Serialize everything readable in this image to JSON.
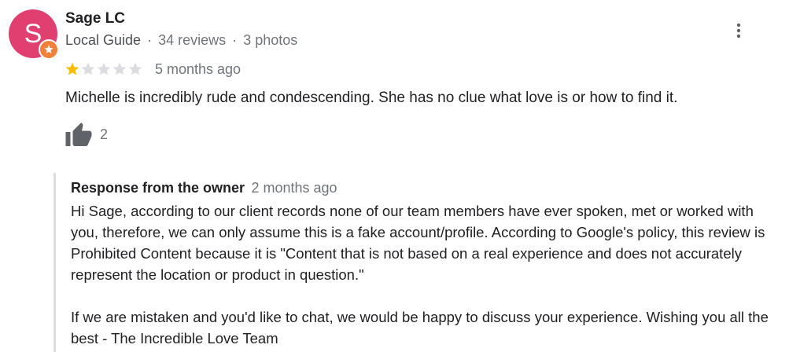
{
  "reviewer": {
    "avatar_letter": "S",
    "avatar_color": "#e13f70",
    "badge_color": "#f2803a",
    "name": "Sage LC",
    "level": "Local Guide",
    "reviews": "34 reviews",
    "photos": "3 photos",
    "separator": "·"
  },
  "review": {
    "rating": 1,
    "max_rating": 5,
    "star_color_filled": "#fbbc04",
    "star_color_empty": "#dadce0",
    "date": "5 months ago",
    "text": "Michelle is incredibly rude and condescending. She has no clue what love is or how to find it.",
    "likes": "2"
  },
  "owner_response": {
    "title": "Response from the owner",
    "date": "2 months ago",
    "paragraph_1": "Hi Sage, according to our client records none of our team members have ever spoken, met or worked with you, therefore, we can only assume this is a fake account/profile. According to Google's policy, this review is Prohibited Content because it is \"Content that is not based on a real experience and does not accurately represent the location or product in question.\"",
    "paragraph_2": "If we are mistaken and you'd like to chat, we would be happy to discuss your experience. Wishing you all the best - The Incredible Love Team"
  },
  "icons": {
    "more": "more-vert-icon",
    "like": "thumb-up-icon",
    "badge": "local-guide-badge-icon",
    "star": "star-icon"
  }
}
